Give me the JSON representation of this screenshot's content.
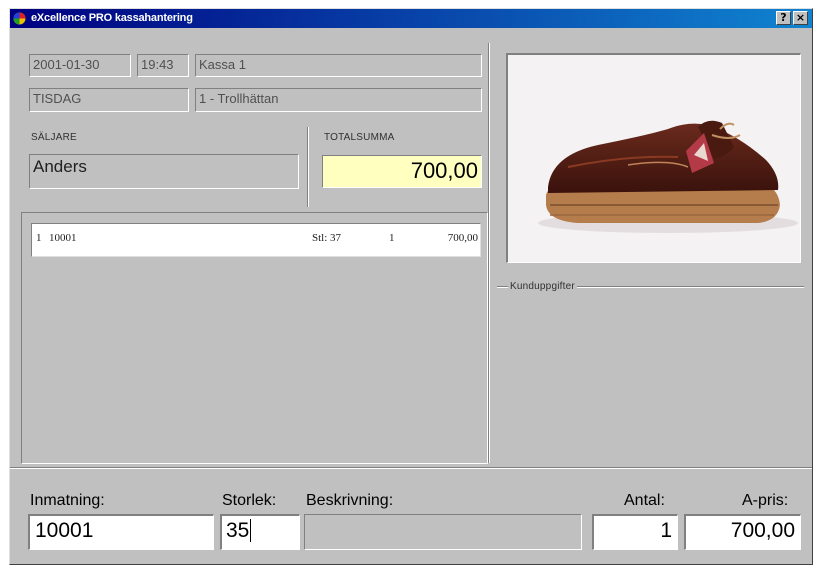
{
  "window": {
    "title": "eXcellence PRO kassahantering",
    "help_glyph": "?",
    "close_glyph": "×"
  },
  "info": {
    "date": "2001-01-30",
    "time": "19:43",
    "register": "Kassa 1",
    "weekday": "TISDAG",
    "store": "1 - Trollhättan"
  },
  "seller": {
    "label": "SÄLJARE",
    "value": "Anders"
  },
  "total": {
    "label": "TOTALSUMMA",
    "value": "700,00",
    "bg_color": "#ffffc0"
  },
  "receipt_rows": [
    {
      "row": "1",
      "article": "10001",
      "size": "Stl: 37",
      "qty": "1",
      "price": "700,00"
    }
  ],
  "customer": {
    "label": "Kunduppgifter"
  },
  "product_image": {
    "icon": "boat-shoe-photo"
  },
  "entry": {
    "input_label": "Inmatning:",
    "input_value": "10001",
    "size_label": "Storlek:",
    "size_value": "35",
    "desc_label": "Beskrivning:",
    "desc_value": "",
    "qty_label": "Antal:",
    "qty_value": "1",
    "price_label": "A-pris:",
    "price_value": "700,00"
  }
}
